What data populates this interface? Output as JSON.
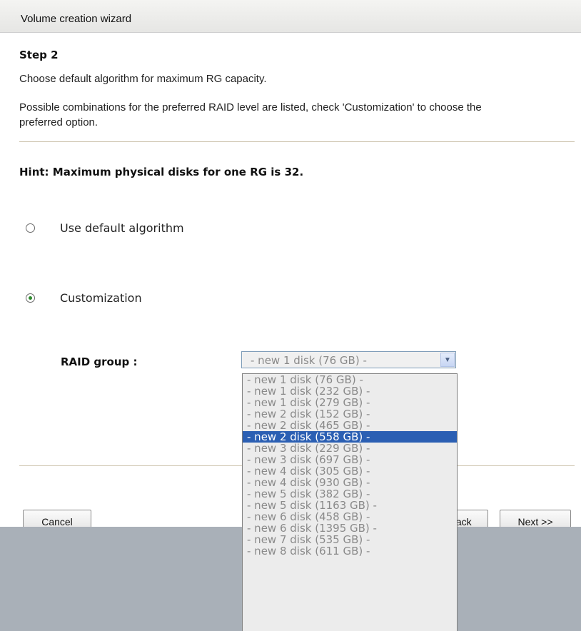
{
  "window": {
    "title": "Volume creation wizard"
  },
  "step": {
    "title": "Step 2",
    "description": "Choose default algorithm for maximum RG capacity.",
    "note": "Possible combinations for the preferred RAID level are listed, check 'Customization' to choose the preferred option."
  },
  "hint": "Hint: Maximum physical disks for one RG is 32.",
  "options": {
    "default_label": "Use default algorithm",
    "default_checked": false,
    "custom_label": "Customization",
    "custom_checked": true
  },
  "raid_group": {
    "label": "RAID group :",
    "selected_value": "- new 1 disk (76 GB) -",
    "highlighted_index": 5,
    "options": [
      "- new 1 disk (76 GB) -",
      "- new 1 disk (232 GB) -",
      "- new 1 disk (279 GB) -",
      "- new 2 disk (152 GB) -",
      "- new 2 disk (465 GB) -",
      "- new 2 disk (558 GB) -",
      "- new 3 disk (229 GB) -",
      "- new 3 disk (697 GB) -",
      "- new 4 disk (305 GB) -",
      "- new 4 disk (930 GB) -",
      "- new 5 disk (382 GB) -",
      "- new 5 disk (1163 GB) -",
      "- new 6 disk (458 GB) -",
      "- new 6 disk (1395 GB) -",
      "- new 7 disk (535 GB) -",
      "- new 8 disk (611 GB) -"
    ]
  },
  "buttons": {
    "cancel": "Cancel",
    "back": "<< Back",
    "next": "Next >>"
  },
  "icons": {
    "dropdown_arrow": "chevron-down-icon"
  },
  "colors": {
    "highlight": "#2b5fb3",
    "footer": "#a9b0b8",
    "radio_checked": "#2e8b2e"
  }
}
